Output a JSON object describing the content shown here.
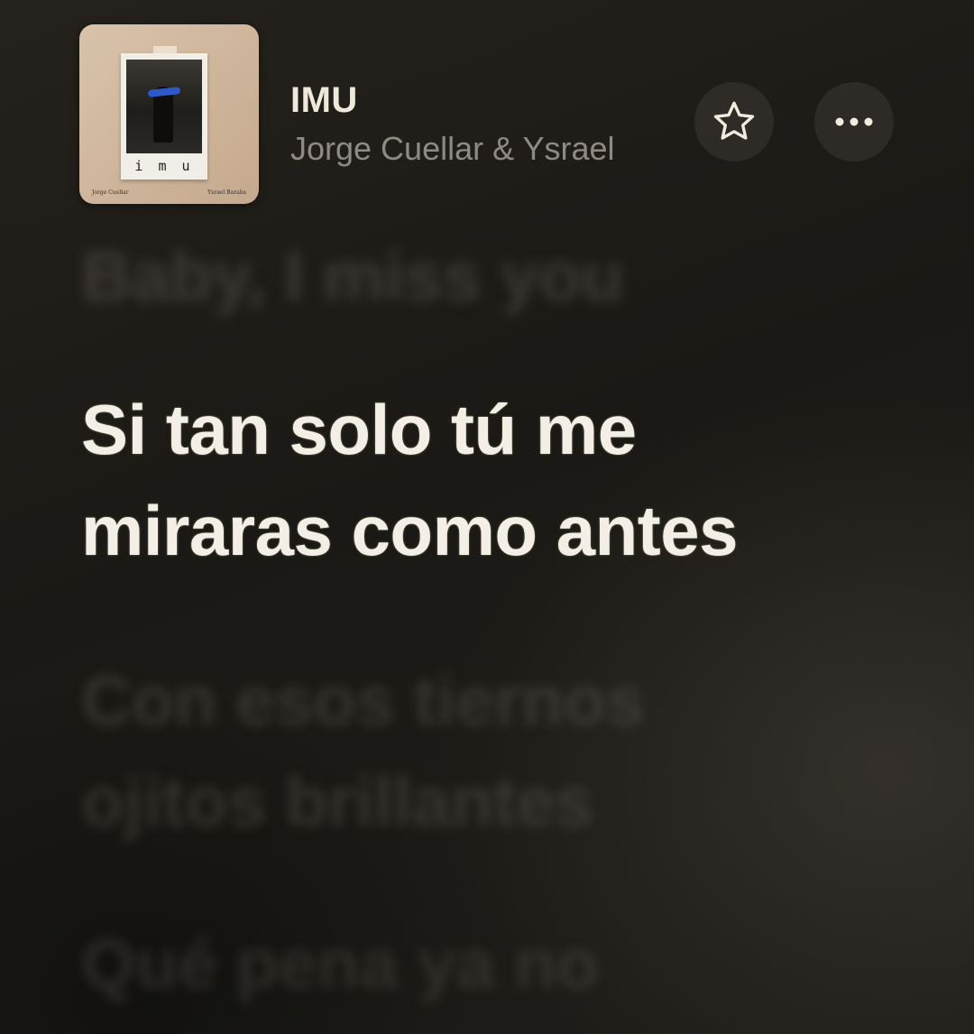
{
  "track": {
    "title": "IMU",
    "artist": "Jorge Cuellar & Ysrael"
  },
  "artwork": {
    "caption": "i m u",
    "credit_left": "Jorge Cuellar",
    "credit_right": "Ysrael Baraba"
  },
  "controls": {
    "favorite_icon": "star-icon",
    "more_icon": "ellipsis-icon"
  },
  "lyrics": {
    "previous": "Baby, I miss you",
    "current_line1": "Si tan solo tú me",
    "current_line2": "miraras como antes",
    "next_line1": "Con esos tiernos",
    "next_line2": "ojitos brillantes",
    "next2_line1": "Qué pena ya no"
  },
  "colors": {
    "background": "#1d1b17",
    "active_lyric": "#f3efe6",
    "artist_text": "#8f8a82"
  }
}
